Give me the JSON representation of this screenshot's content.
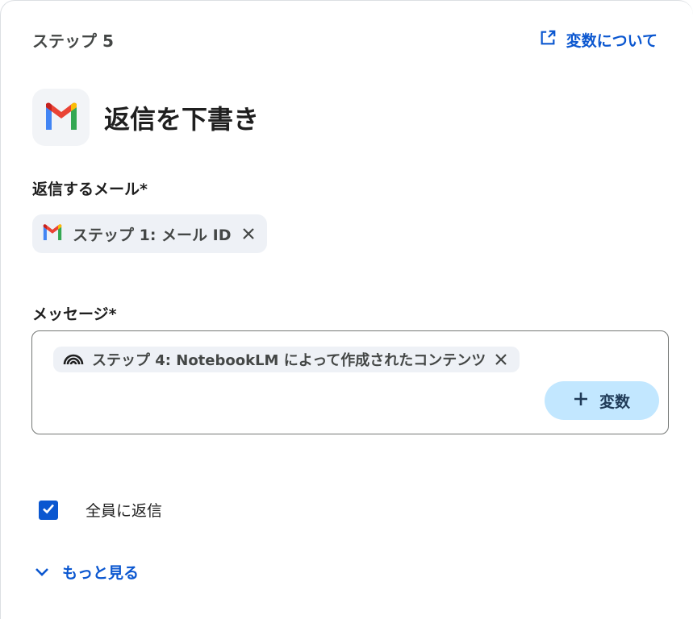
{
  "header": {
    "step_label": "ステップ 5",
    "variables_link": "変数について"
  },
  "action": {
    "title": "返信を下書き",
    "app_icon": "gmail-icon"
  },
  "reply_email": {
    "label": "返信するメール*",
    "chip_text": "ステップ 1: メール ID",
    "chip_icon": "gmail-icon"
  },
  "message": {
    "label": "メッセージ*",
    "chip_text": "ステップ 4: NotebookLM によって作成されたコンテンツ",
    "chip_icon": "notebooklm-icon",
    "add_variable_label": "変数"
  },
  "reply_all": {
    "label": "全員に返信",
    "checked": true
  },
  "more": {
    "label": "もっと見る"
  },
  "colors": {
    "accent": "#0b57d0",
    "chip_bg": "#eef1f6",
    "button_bg": "#c2e7ff"
  }
}
